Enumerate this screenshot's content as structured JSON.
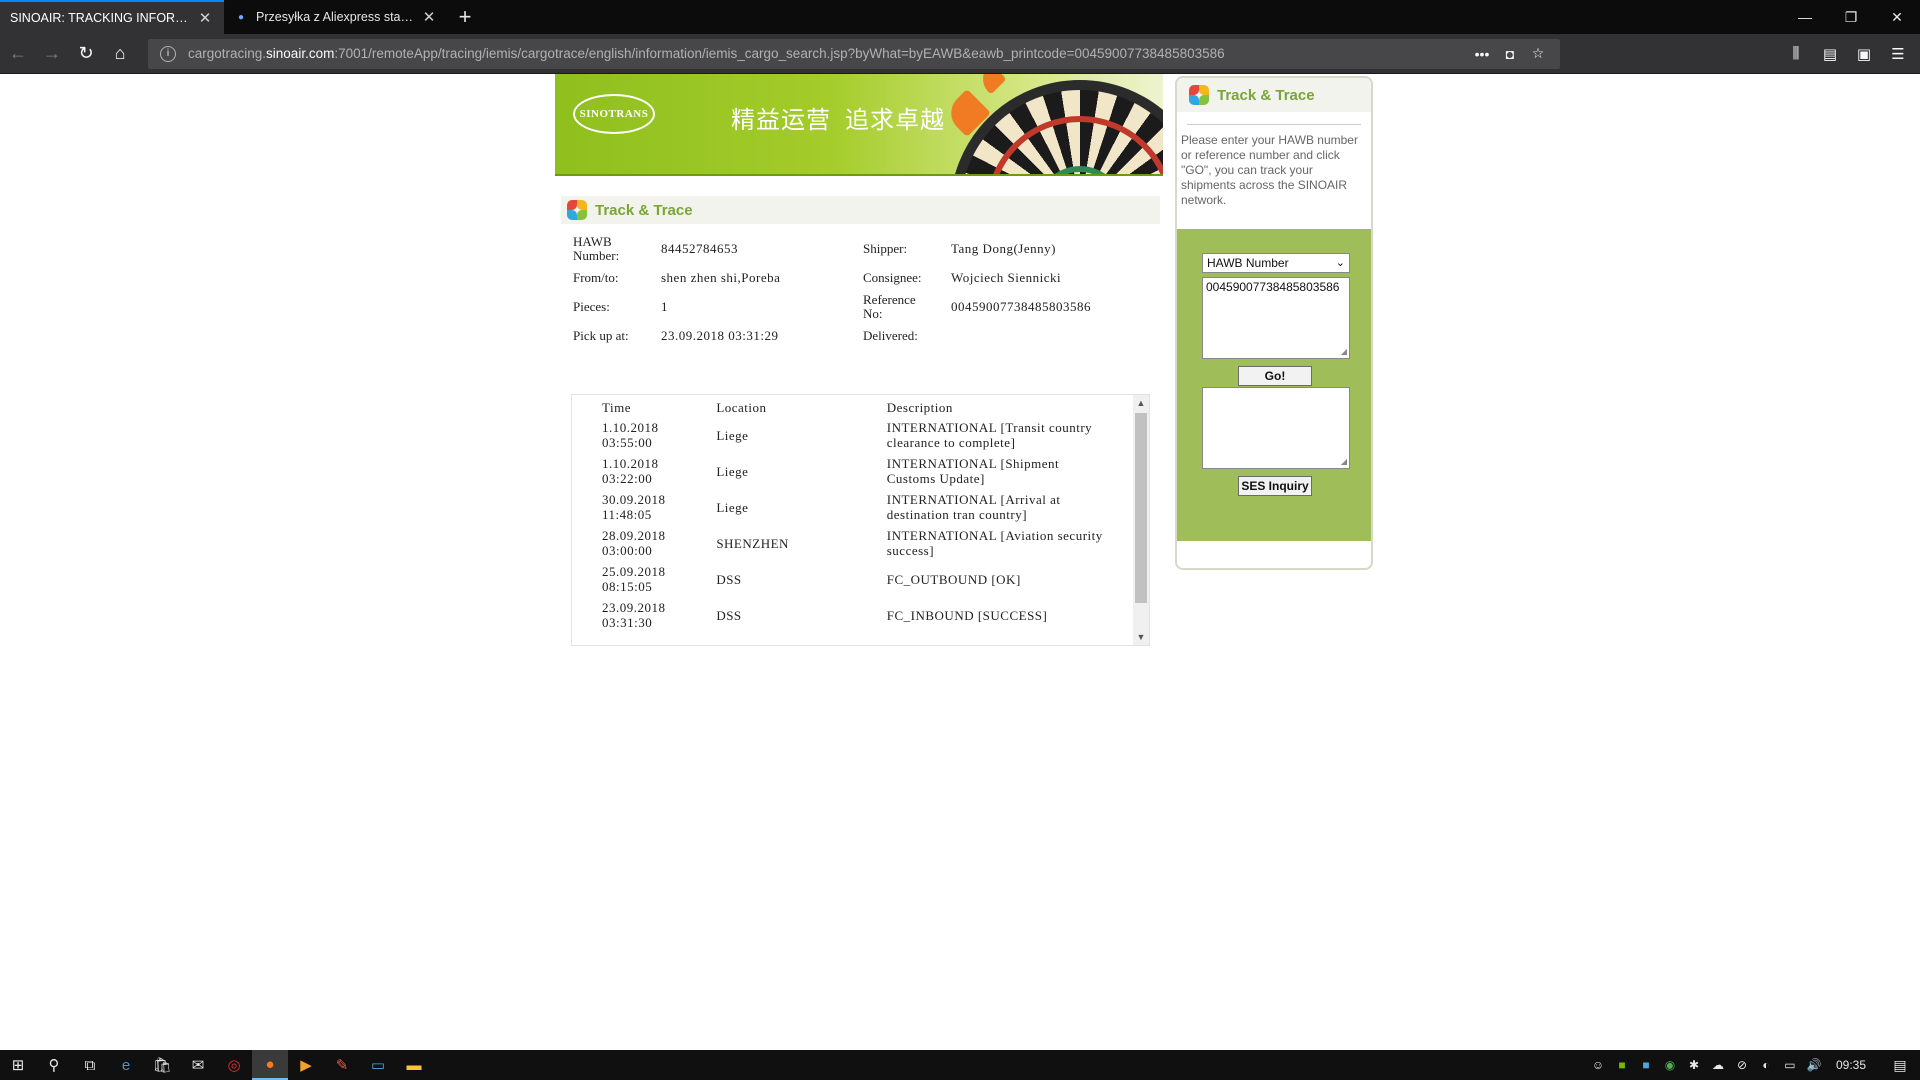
{
  "browser": {
    "tabs": [
      {
        "title": "SINOAIR: TRACKING INFORMATION",
        "active": true
      },
      {
        "title": "Przesyłka z Aliexpress status pr",
        "active": false
      }
    ],
    "url_prefix": "cargotracing.",
    "url_domain": "sinoair.com",
    "url_rest": ":7001/remoteApp/tracing/iemis/cargotrace/english/information/iemis_cargo_search.jsp?byWhat=byEAWB&eawb_printcode=00459007738485803586"
  },
  "banner": {
    "logo_text": "SINOTRANS",
    "slogan_1": "精益运营",
    "slogan_2": "追求卓越"
  },
  "main": {
    "section_title": "Track & Trace",
    "fields": {
      "hawb_label_1": "HAWB",
      "hawb_label_2": "Number:",
      "hawb_value": "84452784653",
      "shipper_label": "Shipper:",
      "shipper_value": "Tang Dong(Jenny)",
      "fromto_label": "From/to:",
      "fromto_value": "shen zhen shi,Poreba",
      "consignee_label": "Consignee:",
      "consignee_value": "Wojciech Siennicki",
      "pieces_label": "Pieces:",
      "pieces_value": "1",
      "reference_label_1": "Reference",
      "reference_label_2": "No:",
      "reference_value": "00459007738485803586",
      "pickup_label": "Pick up at:",
      "pickup_value": "23.09.2018 03:31:29",
      "delivered_label": "Delivered:",
      "delivered_value": ""
    },
    "events_headers": {
      "time": "Time",
      "location": "Location",
      "description": "Description"
    },
    "events": [
      {
        "date": "1.10.2018",
        "time": "03:55:00",
        "location": "Liege",
        "desc_1": "INTERNATIONAL [Transit country",
        "desc_2": "clearance to complete]"
      },
      {
        "date": "1.10.2018",
        "time": "03:22:00",
        "location": "Liege",
        "desc_1": "INTERNATIONAL [Shipment",
        "desc_2": "Customs Update]"
      },
      {
        "date": "30.09.2018",
        "time": "11:48:05",
        "location": "Liege",
        "desc_1": "INTERNATIONAL [Arrival at",
        "desc_2": "destination tran country]"
      },
      {
        "date": "28.09.2018",
        "time": "03:00:00",
        "location": "SHENZHEN",
        "desc_1": "INTERNATIONAL [Aviation security",
        "desc_2": "success]"
      },
      {
        "date": "25.09.2018",
        "time": "08:15:05",
        "location": "DSS",
        "desc_1": "FC_OUTBOUND [OK]",
        "desc_2": ""
      },
      {
        "date": "23.09.2018",
        "time": "03:31:30",
        "location": "DSS",
        "desc_1": "FC_INBOUND [SUCCESS]",
        "desc_2": ""
      }
    ]
  },
  "sidebar": {
    "title": "Track & Trace",
    "help_text": "Please enter your HAWB number or reference number and click \"GO\", you can track your shipments across the SINOAIR network.",
    "select_value": "HAWB Number",
    "textarea_value": "00459007738485803586",
    "go_label": "Go!",
    "ses_label": "SES Inquiry"
  },
  "taskbar": {
    "clock": "09:35"
  }
}
